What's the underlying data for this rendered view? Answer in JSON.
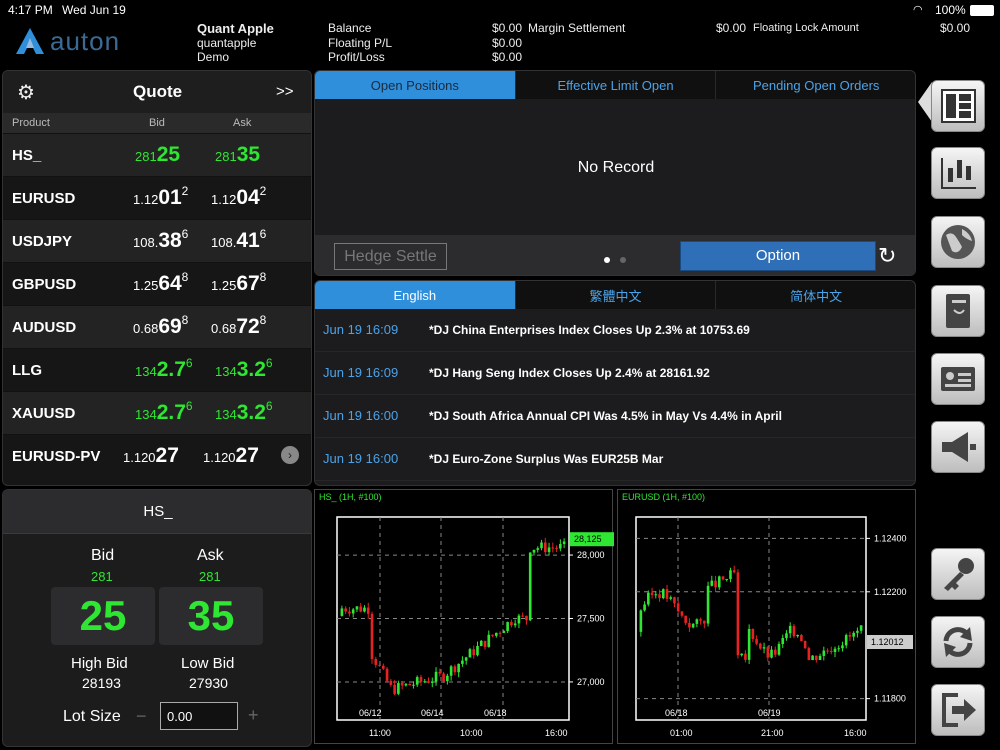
{
  "status": {
    "time": "4:17 PM",
    "date": "Wed Jun 19",
    "battery": "100%"
  },
  "brand": {
    "name": "auton"
  },
  "account": {
    "name": "Quant Apple",
    "user": "quantapple",
    "mode": "Demo"
  },
  "balances": {
    "balance_label": "Balance",
    "balance_value": "$0.00",
    "floating_label": "Floating P/L",
    "floating_value": "$0.00",
    "profit_label": "Profit/Loss",
    "profit_value": "$0.00",
    "margin_label": "Margin Settlement",
    "margin_value": "$0.00",
    "lock_label": "Floating Lock Amount",
    "lock_value": "$0.00"
  },
  "quote": {
    "title": "Quote",
    "expand": ">>",
    "col_product": "Product",
    "col_bid": "Bid",
    "col_ask": "Ask",
    "rows": [
      {
        "product": "HS_",
        "bid_pre": "281",
        "bid_big": "25",
        "bid_sup": "",
        "ask_pre": "281",
        "ask_big": "35",
        "ask_sup": "",
        "color": "green"
      },
      {
        "product": "EURUSD",
        "bid_pre": "1.12",
        "bid_big": "01",
        "bid_sup": "2",
        "ask_pre": "1.12",
        "ask_big": "04",
        "ask_sup": "2",
        "color": "white"
      },
      {
        "product": "USDJPY",
        "bid_pre": "108.",
        "bid_big": "38",
        "bid_sup": "6",
        "ask_pre": "108.",
        "ask_big": "41",
        "ask_sup": "6",
        "color": "white"
      },
      {
        "product": "GBPUSD",
        "bid_pre": "1.25",
        "bid_big": "64",
        "bid_sup": "8",
        "ask_pre": "1.25",
        "ask_big": "67",
        "ask_sup": "8",
        "color": "white"
      },
      {
        "product": "AUDUSD",
        "bid_pre": "0.68",
        "bid_big": "69",
        "bid_sup": "8",
        "ask_pre": "0.68",
        "ask_big": "72",
        "ask_sup": "8",
        "color": "white"
      },
      {
        "product": "LLG",
        "bid_pre": "134",
        "bid_big": "2.7",
        "bid_sup": "6",
        "ask_pre": "134",
        "ask_big": "3.2",
        "ask_sup": "6",
        "color": "green"
      },
      {
        "product": "XAUUSD",
        "bid_pre": "134",
        "bid_big": "2.7",
        "bid_sup": "6",
        "ask_pre": "134",
        "ask_big": "3.2",
        "ask_sup": "6",
        "color": "green"
      },
      {
        "product": "EURUSD-PV",
        "bid_pre": "1.120",
        "bid_big": "27",
        "bid_sup": "",
        "ask_pre": "1.120",
        "ask_big": "27",
        "ask_sup": "",
        "color": "white"
      }
    ]
  },
  "ticket": {
    "symbol": "HS_",
    "bid_label": "Bid",
    "ask_label": "Ask",
    "bid_pre": "281",
    "ask_pre": "281",
    "bid_big": "25",
    "ask_big": "35",
    "high_label": "High Bid",
    "high_value": "28193",
    "low_label": "Low Bid",
    "low_value": "27930",
    "lot_label": "Lot Size",
    "lot_value": "0.00",
    "minus": "−",
    "plus": "+"
  },
  "positions": {
    "tabs": [
      "Open Positions",
      "Effective Limit Open",
      "Pending Open Orders"
    ],
    "empty": "No Record",
    "hedge": "Hedge Settle",
    "option": "Option"
  },
  "newspanel": {
    "tabs": [
      "English",
      "繁體中文",
      "简体中文"
    ],
    "items": [
      {
        "time": "Jun 19 16:09",
        "headline": "*DJ China Enterprises Index Closes Up 2.3% at 10753.69"
      },
      {
        "time": "Jun 19 16:09",
        "headline": "*DJ Hang Seng Index Closes Up 2.4% at 28161.92"
      },
      {
        "time": "Jun 19 16:00",
        "headline": "*DJ South Africa Annual CPI Was 4.5% in May Vs 4.4% in April"
      },
      {
        "time": "Jun 19 16:00",
        "headline": "*DJ Euro-Zone Surplus Was EUR25B Mar"
      }
    ]
  },
  "chart_data": [
    {
      "type": "candlestick",
      "title": "HS_ (1H, #100)",
      "yticks": [
        "28,000",
        "27,500",
        "27,000"
      ],
      "ylim": [
        26700,
        28300
      ],
      "last": "28,125",
      "date_labels": [
        "06/12",
        "06/14",
        "06/18"
      ],
      "time_labels": [
        "11:00",
        "10:00",
        "16:00"
      ]
    },
    {
      "type": "candlestick",
      "title": "EURUSD (1H, #100)",
      "yticks": [
        "1.12400",
        "1.12200",
        "1.11800"
      ],
      "ylim": [
        1.1172,
        1.1248
      ],
      "last": "1.12012",
      "date_labels": [
        "06/18",
        "06/19"
      ],
      "time_labels": [
        "01:00",
        "21:00",
        "16:00"
      ]
    }
  ],
  "colors": {
    "up": "#2fe632",
    "down": "#e62222",
    "accent": "#2f8fdb"
  }
}
